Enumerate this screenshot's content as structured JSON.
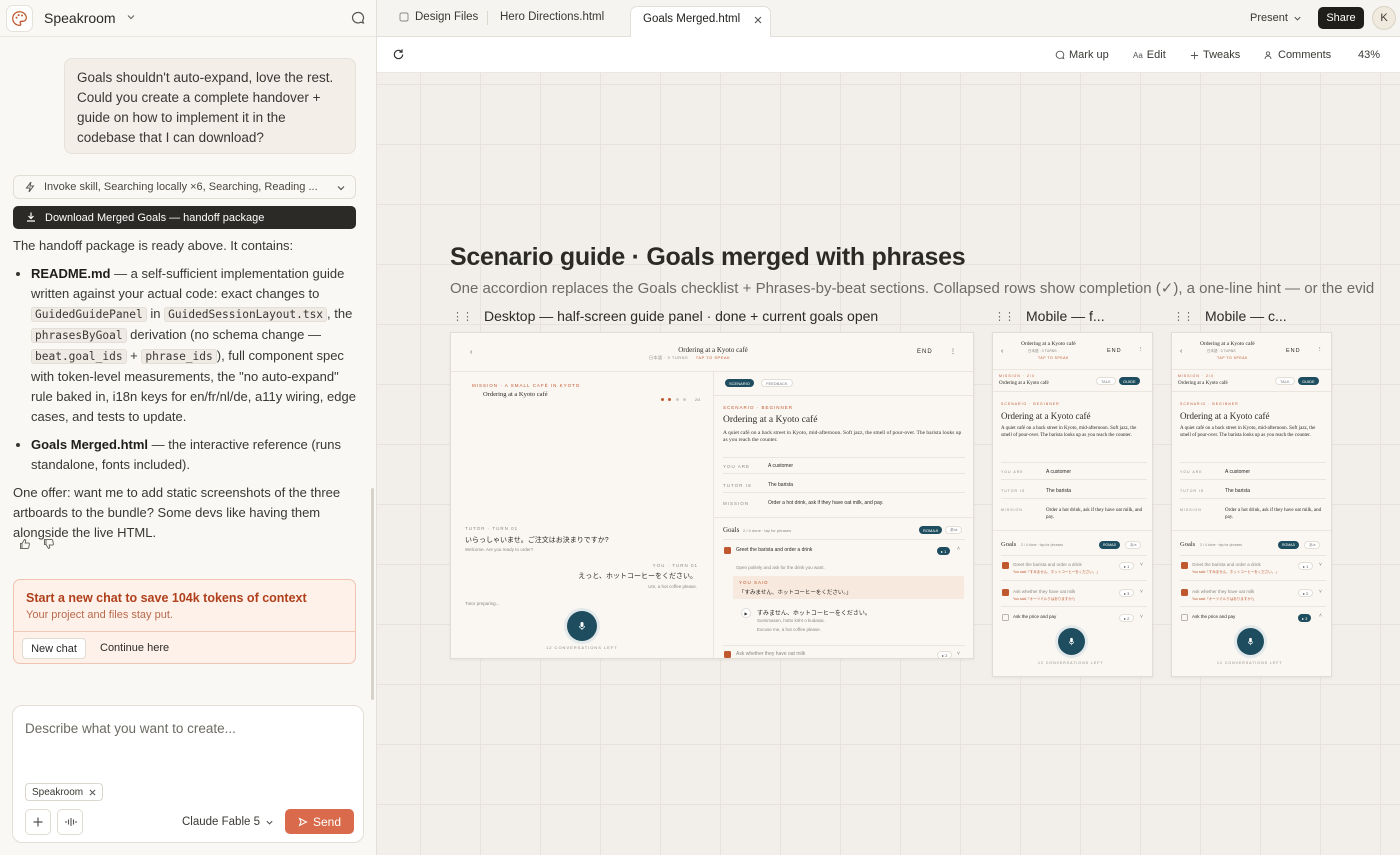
{
  "sidebar": {
    "project_name": "Speakroom",
    "user_message": "Goals shouldn't auto-expand, love the rest. Could you create a complete handover + guide on how to implement it in the codebase that I can download?",
    "tool_summary": "Invoke skill, Searching locally ×6, Searching, Reading ...",
    "download_label": "Download Merged Goals — handoff package",
    "reply_intro": "The handoff package is ready above. It contains:",
    "bullet1": {
      "title": "README.md",
      "t1": " — a self-sufficient implementation guide written against your actual code: exact changes to ",
      "c1": "GuidedGuidePanel",
      "t2": " in ",
      "c2": "GuidedSessionLayout.tsx",
      "t3": ", the ",
      "c3": "phrasesByGoal",
      "t4": " derivation (no schema change — ",
      "c4": "beat.goal_ids",
      "t5": " + ",
      "c5": "phrase_ids",
      "t6": "), full component spec with token-level measurements, the \"no auto-expand\" rule baked in, i18n keys for en/fr/nl/de, a11y wiring, edge cases, and tests to update."
    },
    "bullet2": {
      "title": "Goals Merged.html",
      "text": " — the interactive reference (runs standalone, fonts included)."
    },
    "reply_offer": "One offer: want me to add static screenshots of the three artboards to the bundle? Some devs like having them alongside the live HTML.",
    "context_banner": {
      "title": "Start a new chat to save 104k tokens of context",
      "subtitle": "Your project and files stay put.",
      "new_chat": "New chat",
      "continue": "Continue here"
    },
    "composer": {
      "placeholder": "Describe what you want to create...",
      "chip": "Speakroom",
      "model": "Claude Fable 5",
      "send": "Send"
    }
  },
  "tabs": [
    {
      "label": "Design Files"
    },
    {
      "label": "Hero Directions.html"
    },
    {
      "label": "Goals Merged.html",
      "active": true
    }
  ],
  "header": {
    "present": "Present",
    "share": "Share",
    "avatar": "K"
  },
  "toolbar": {
    "markup": "Mark up",
    "edit": "Edit",
    "tweaks": "Tweaks",
    "comments": "Comments",
    "zoom": "43%"
  },
  "canvas": {
    "title": "Scenario guide · Goals merged with phrases",
    "subtitle": "One accordion replaces the Goals checklist + Phrases-by-beat sections. Collapsed rows show completion (✓), a one-line hint — or the evid",
    "boards": [
      {
        "label": "Desktop — half-screen guide panel · done + current goals open"
      },
      {
        "label": "Mobile — f..."
      },
      {
        "label": "Mobile — c..."
      }
    ]
  },
  "mock": {
    "scene_title": "Ordering at a Kyoto café",
    "scene_meta": "日本語 · 3 TURNS",
    "tap": "TAP TO SPEAK",
    "end": "END",
    "mission_label": "MISSION · A SMALL CAFÉ IN KYOTO",
    "mission_label_short": "MISSION · 2/4",
    "mission_title": "Ordering at a Kyoto café",
    "progress": "2/4",
    "tab_scenario": "SCENARIO",
    "tab_feedback": "FEEDBACK",
    "tab_talk": "TALK",
    "tab_guide": "GUIDE",
    "eyebrow": "SCENARIO · BEGINNER",
    "heading": "Ordering at a Kyoto café",
    "desc": "A quiet café on a back street in Kyoto, mid-afternoon. Soft jazz, the smell of pour-over. The barista looks up as you reach the counter.",
    "you_are_k": "YOU ARE",
    "you_are_v": "A customer",
    "tutor_k": "TUTOR IS",
    "tutor_v": "The barista",
    "mission_k": "MISSION",
    "mission_v": "Order a hot drink, ask if they have oat milk, and pay.",
    "goals": "Goals",
    "goals_meta": "2 / 4 done · tap for phrases",
    "romaji": "ROMAJI",
    "kana": "あ/a",
    "goal1": "Greet the barista and order a drink",
    "goal1_hint": "Open politely and ask for the drink you want.",
    "you_said_label": "YOU SAID",
    "you_said": "「すみません、ホットコーヒーをください。」",
    "you_said_short": "You said「すみません、ホットコーヒーをください。」",
    "phrase_jp": "すみません、ホットコーヒーをください。",
    "phrase_romaji": "Sumimasen, hotto kōhī o kudasai.",
    "phrase_en": "Excuse me, a hot coffee please.",
    "goal2": "Ask whether they have oat milk",
    "goal2_short": "Ask whether they have oat milk",
    "goal2_said": "You said「オーツミルクはありますか?」",
    "goal3": "Ask the price and pay",
    "tutor_turn": "TUTOR · TURN 01",
    "tutor_line": "いらっしゃいませ。ご注文はお決まりですか?",
    "tutor_trans": "Welcome. Are you ready to order?",
    "you_turn": "YOU · TURN 01",
    "you_line": "えっと、ホットコーヒーをください。",
    "you_trans": "Um, a hot coffee please.",
    "preparing": "Tutor preparing...",
    "left_count": "12 CONVERSATIONS LEFT",
    "badge1": "▸ 1",
    "badge2": "▸ 2",
    "badge3": "▸ 3"
  },
  "colors": {
    "accent": "#d96b4c",
    "ink": "#1d4d5e",
    "dark": "#1f1e1b"
  }
}
